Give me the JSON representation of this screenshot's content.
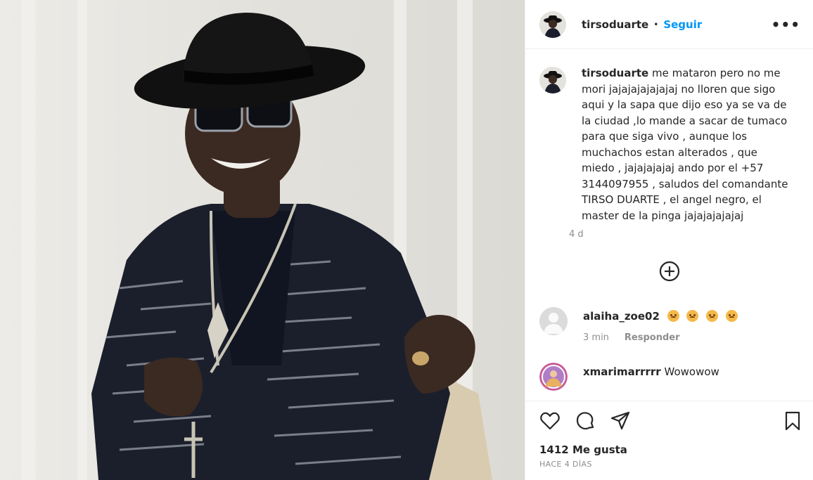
{
  "post": {
    "username": "tirsoduarte",
    "follow_label": "Seguir",
    "separator": "•",
    "more_icon": "more-icon",
    "caption": {
      "username": "tirsoduarte",
      "text": "me mataron pero no me mori jajajajajajajaj no lloren que sigo aqui y la sapa que dijo eso ya se va de la ciudad ,lo mande a sacar de tumaco para que siga vivo , aunque los muchachos estan alterados , que miedo , jajajajajaj ando por el +57 3144097955 , saludos del comandante TIRSO DUARTE , el angel negro, el master de la pinga jajajajajajaj",
      "time": "4 d"
    },
    "load_more_icon": "plus-circle-icon",
    "comments": [
      {
        "username": "alaiha_zoe02",
        "text": "",
        "emoji_count": 4,
        "time": "3 min",
        "reply_label": "Responder"
      },
      {
        "username": "xmarimarrrrr",
        "text": "Wowowow"
      }
    ],
    "likes": "1412 Me gusta",
    "date": "HACE 4 DÍAS"
  },
  "colors": {
    "link": "#0095f6",
    "text": "#262626",
    "muted": "#8e8e8e",
    "divider": "#efefef"
  }
}
